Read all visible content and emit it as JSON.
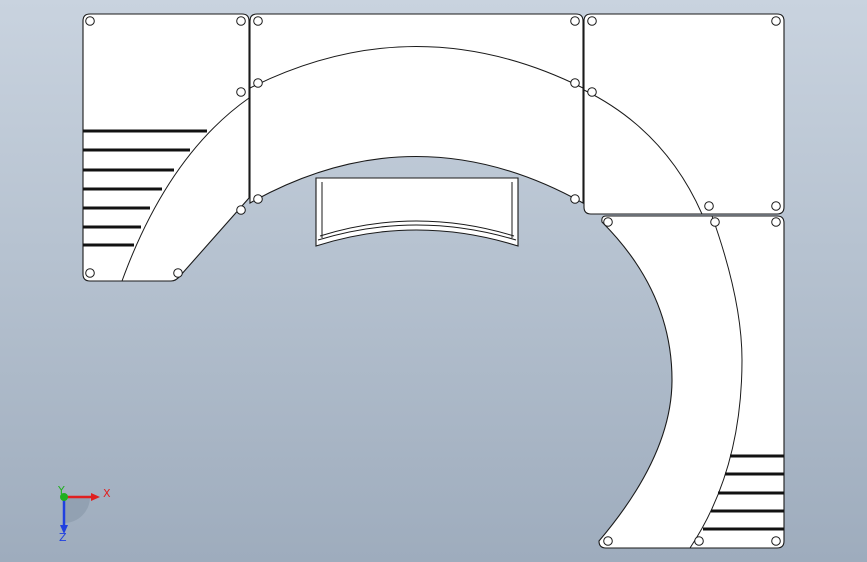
{
  "triad": {
    "x_label": "X",
    "y_label": "Y",
    "z_label": "Z",
    "x_color": "#e02020",
    "y_color": "#20b020",
    "z_color": "#2040e0"
  },
  "background": {
    "top_color": "#c9d3df",
    "bottom_color": "#9eacbd"
  }
}
